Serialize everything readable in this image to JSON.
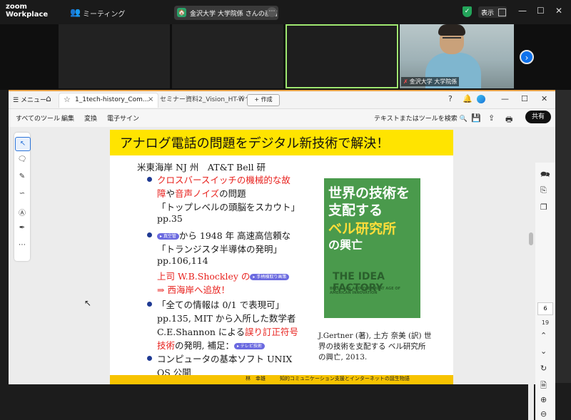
{
  "zoom": {
    "logo_top": "zoom",
    "logo_bottom": "Workplace",
    "meeting_label": "ミーティング",
    "share_label": "金沢大学 大学院係 さんの画面",
    "view_label": "表示",
    "participant_name": "金沢大学 大学院係"
  },
  "acrobat": {
    "menu_label": "メニュー",
    "tab1": "1_1tech-history_Com...",
    "tab2": "セミナー資料2_Vision_HT-W^...",
    "create_label": "+ 作成",
    "menu": [
      "すべてのツール",
      "編集",
      "変換",
      "電子サイン"
    ],
    "search_tools": "テキストまたはツールを検索",
    "share_button": "共有",
    "page_current": "6",
    "page_total": "19"
  },
  "slide": {
    "title": "アナログ電話の問題をデジタル新技術で解決！",
    "location": "米東海岸 NJ 州　AT&T Bell 研",
    "b1_red1": "クロスバースイッチの機械的な故",
    "b1_red2a": "障",
    "b1_mid": "や",
    "b1_red2b": "音声ノイズ",
    "b1_end": "の問題",
    "b1_line3": "「トップレベルの頭脳をスカウト」",
    "b1_line4": "pp.35",
    "pill_vacuum": "▸ 真空管",
    "b2_line1": "から 1948 年 高速高信頼な",
    "b2_line2": "「トランジスタ半導体の発明」",
    "b2_line3": "pp.106,114",
    "b2_red1": "上司 W.B.Shockley の",
    "pill_credit": "▸ 手柄横取り画策",
    "b2_red2": "⇒ 西海岸へ追放！",
    "b3_line1": "「全ての情報は 0/1 で表現可」",
    "b3_line2": "pp.135, MIT から入所した数学者",
    "b3_line3a": "C.E.Shannon による",
    "b3_line3b": "誤り訂正符号",
    "b3_line4a": "技術",
    "b3_line4b": "の発明, 補足：",
    "pill_tv": "▸ テレビ技術",
    "b4_line1": "コンピュータの基本ソフト UNIX",
    "b4_line2": "OS 公開",
    "book_line1": "世界の技術を",
    "book_line2": "支配する",
    "book_line3": "ベル研究所",
    "book_line4": "の興亡",
    "book_en": "THE IDEA FACTORY",
    "book_en_sub": "BELL LABS AND THE GREAT AGE OF AMERICAN INNOVATION",
    "caption": "J.Gertner (著), 土方 奈美 (訳) 世界の技術を支配する ベル研究所の興亡, 2013.",
    "footer_author": "林　幸雄",
    "footer_series": "知的コミュニケーション支援とインターネットの誕生物語"
  },
  "colors": {
    "accent": "#ffe400",
    "zoom_blue": "#0e72ed",
    "slide_red": "#e8221e"
  }
}
